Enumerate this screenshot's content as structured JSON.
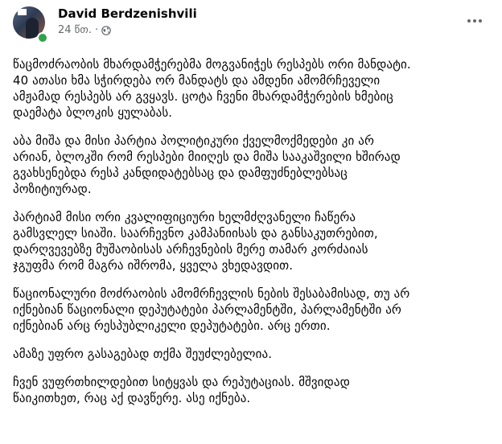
{
  "post": {
    "author": "David Berdzenishvili",
    "time": "24 წთ.",
    "privacy_icon": "globe-icon",
    "paragraphs": [
      "წაცმოძრაობის მხარდამჭერებმა  მოგვანიჭეს რესპებს ორი მანდატი.\n40 ათასი ხმა სჭირდება ორ მანდატს და ამდენი ამომრჩეველი\nამჟამად რესპებს არ გვყავს. ცოტა ჩვენი მხარდამჭერების ხმებიც\nდაემატა ბლოკის ყულაბას.",
      "აბა მიშა და მისი პარტია  პოლიტიკური ქველმოქმედები კი არ\nარიან, ბლოკში რომ რესპები მიიღეს და მიშა სააკაშვილი ხშირად\nგვახსენებდა რესპ კანდიდატებსაც და დამფუძნებლებსაც\nპოზიტიურად.",
      "პარტიამ მისი ორი კვალიფიციური ხელმძღვანელი ჩაწერა\nგამსვლელ  სიაში. საარჩევნო კამპანიისას და განსაკუთრებით,\nდარღვევებზე მუშაობისას არჩევნების მერე თამარ კორძაიას\nჯგუფმა რომ მაგრა იშრომა, ყველა ვხედავდით.",
      "წაციონალური მოძრაობის  ამომრჩევლის ნების შესაბამისად, თუ არ\nიქნებიან წაციონალი  დეპუტატები პარლამენტში, პარლამენტში არ\nიქნებიან არც რესპუბლიკელი  დეპუტატები. არც ერთი.",
      "ამაზე უფრო გასაგებად თქმა შეუძლებელია.",
      "ჩვენ ვუფრთხილდებით სიტყვას და რეპუტაციას.  მშვიდად\nწაიკითხეთ, რაც აქ დავწერე. ასე იქნება."
    ]
  }
}
